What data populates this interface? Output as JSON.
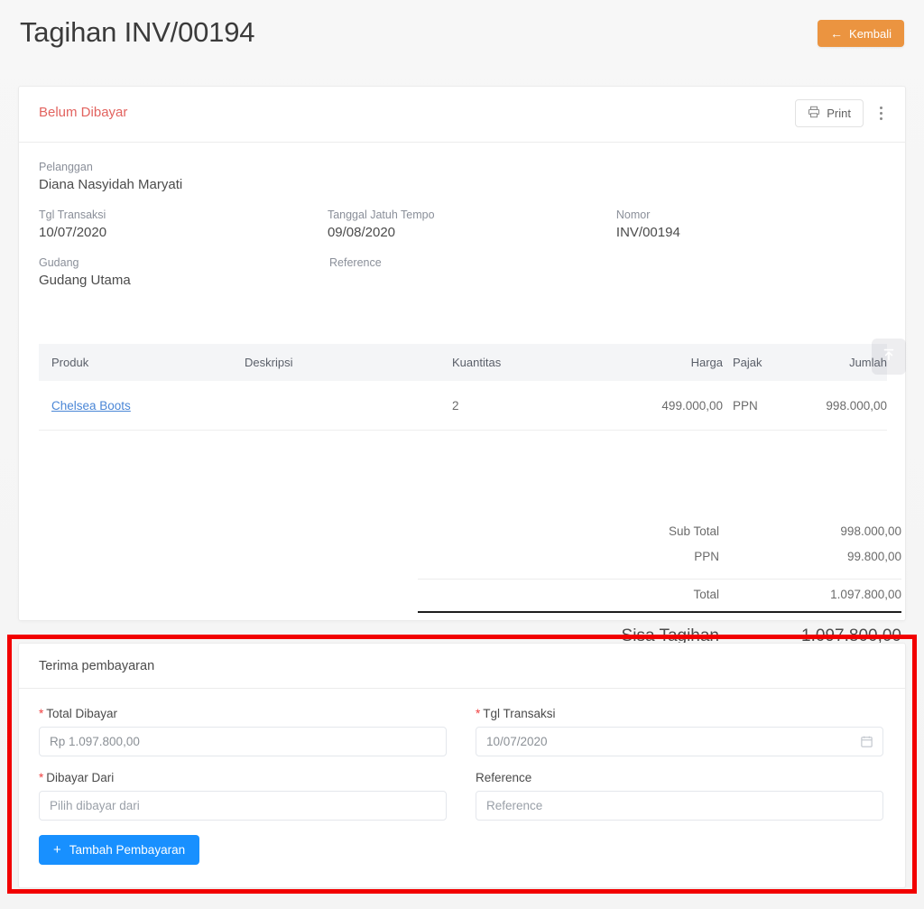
{
  "header": {
    "title": "Tagihan INV/00194",
    "back_button": {
      "label": "Kembali",
      "icon": "arrow-left-icon",
      "color": "#eb9440"
    }
  },
  "invoice_card": {
    "status": {
      "label": "Belum Dibayar",
      "color": "#e2635f"
    },
    "actions": {
      "print_label": "Print",
      "print_icon": "printer-icon",
      "more_icon": "kebab-menu-icon"
    },
    "meta": {
      "pelanggan_label": "Pelanggan",
      "pelanggan_value": "Diana Nasyidah Maryati",
      "tgl_transaksi_label": "Tgl Transaksi",
      "tgl_transaksi_value": "10/07/2020",
      "jatuh_tempo_label": "Tanggal Jatuh Tempo",
      "jatuh_tempo_value": "09/08/2020",
      "nomor_label": "Nomor",
      "nomor_value": "INV/00194",
      "gudang_label": "Gudang",
      "gudang_value": "Gudang Utama",
      "reference_label": "Reference",
      "reference_value": ""
    },
    "table": {
      "columns": {
        "produk": "Produk",
        "deskripsi": "Deskripsi",
        "kuantitas": "Kuantitas",
        "harga": "Harga",
        "pajak": "Pajak",
        "jumlah": "Jumlah"
      },
      "rows": [
        {
          "produk": "Chelsea Boots",
          "deskripsi": "",
          "kuantitas": "2",
          "harga": "499.000,00",
          "pajak": "PPN",
          "jumlah": "998.000,00"
        }
      ]
    },
    "totals": {
      "sub_total_label": "Sub Total",
      "sub_total_value": "998.000,00",
      "ppn_label": "PPN",
      "ppn_value": "99.800,00",
      "total_label": "Total",
      "total_value": "1.097.800,00",
      "sisa_label": "Sisa Tagihan",
      "sisa_value": "1.097.800,00"
    },
    "float_button_icon": "scroll-to-top-icon"
  },
  "payment_card": {
    "title": "Terima pembayaran",
    "fields": {
      "total_dibayar_label": "Total Dibayar",
      "total_dibayar_value": "Rp 1.097.800,00",
      "tgl_transaksi_label": "Tgl Transaksi",
      "tgl_transaksi_value": "10/07/2020",
      "dibayar_dari_label": "Dibayar Dari",
      "dibayar_dari_placeholder": "Pilih dibayar dari",
      "reference_label": "Reference",
      "reference_placeholder": "Reference"
    },
    "submit_button": {
      "label": "Tambah Pembayaran",
      "icon": "plus-icon",
      "color": "#1890ff"
    },
    "calendar_icon": "calendar-icon"
  },
  "annotation": {
    "color": "#f20000"
  }
}
